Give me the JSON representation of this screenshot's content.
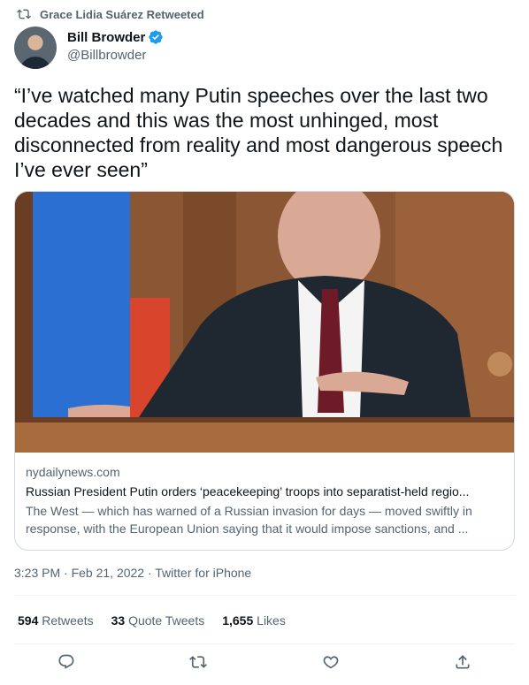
{
  "retweet": {
    "icon": "retweet-icon",
    "text": "Grace Lidia Suárez Retweeted"
  },
  "author": {
    "name": "Bill Browder",
    "handle": "@Billbrowder",
    "verified_icon": "verified-badge-icon",
    "accent": "#1d9bf0"
  },
  "tweet": {
    "text": "“I’ve watched many Putin speeches over the last two decades and this was the most unhinged, most disconnected from reality and most dangerous speech I’ve ever seen”"
  },
  "card": {
    "domain": "nydailynews.com",
    "title": "Russian President Putin orders ‘peacekeeping’ troops into separatist-held regio...",
    "description": "The West — which has warned of a Russian invasion for days — moved swiftly in response, with the European Union saying that it would impose sanctions, and ..."
  },
  "meta": {
    "time": "3:23 PM · Feb 21, 2022 · Twitter for iPhone"
  },
  "stats": {
    "retweets_count": "594",
    "retweets_label": "Retweets",
    "quotes_count": "33",
    "quotes_label": "Quote Tweets",
    "likes_count": "1,655",
    "likes_label": "Likes"
  },
  "actions": [
    "reply-icon",
    "retweet-icon",
    "like-icon",
    "share-icon"
  ]
}
